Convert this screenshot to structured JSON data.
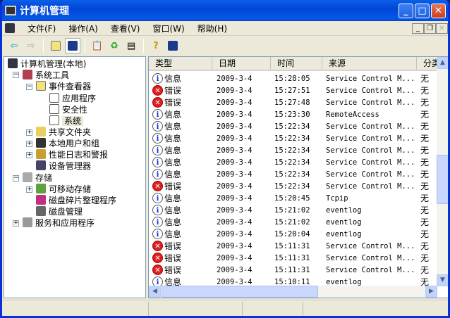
{
  "window": {
    "title": "计算机管理",
    "buttons": {
      "minimize": "_",
      "maximize": "□",
      "close": "✕"
    }
  },
  "menu": [
    "文件(F)",
    "操作(A)",
    "查看(V)",
    "窗口(W)",
    "帮助(H)"
  ],
  "mdi_buttons": {
    "minimize": "_",
    "restore": "❐",
    "close": "✕"
  },
  "toolbar": [
    "back-icon",
    "forward-icon",
    "up-folder-icon",
    "show-hide-tree-icon",
    "properties-icon",
    "refresh-icon",
    "export-list-icon",
    "help-icon",
    "show-action-pane-icon"
  ],
  "tree": {
    "root": "计算机管理(本地)",
    "system_tools": "系统工具",
    "event_viewer": "事件查看器",
    "application": "应用程序",
    "security": "安全性",
    "system": "系统",
    "shared_folders": "共享文件夹",
    "local_users": "本地用户和组",
    "perf_logs": "性能日志和警报",
    "device_manager": "设备管理器",
    "storage": "存储",
    "removable": "可移动存储",
    "defrag": "磁盘碎片整理程序",
    "disk_mgmt": "磁盘管理",
    "services_apps": "服务和应用程序"
  },
  "table": {
    "columns": [
      "类型",
      "日期",
      "时间",
      "来源",
      "分类"
    ],
    "rows": [
      {
        "type": "信息",
        "kind": "info",
        "date": "2009-3-4",
        "time": "15:28:05",
        "source": "Service Control M...",
        "category": "无"
      },
      {
        "type": "错误",
        "kind": "error",
        "date": "2009-3-4",
        "time": "15:27:51",
        "source": "Service Control M...",
        "category": "无"
      },
      {
        "type": "错误",
        "kind": "error",
        "date": "2009-3-4",
        "time": "15:27:48",
        "source": "Service Control M...",
        "category": "无"
      },
      {
        "type": "信息",
        "kind": "info",
        "date": "2009-3-4",
        "time": "15:23:30",
        "source": "RemoteAccess",
        "category": "无"
      },
      {
        "type": "信息",
        "kind": "info",
        "date": "2009-3-4",
        "time": "15:22:34",
        "source": "Service Control M...",
        "category": "无"
      },
      {
        "type": "信息",
        "kind": "info",
        "date": "2009-3-4",
        "time": "15:22:34",
        "source": "Service Control M...",
        "category": "无"
      },
      {
        "type": "信息",
        "kind": "info",
        "date": "2009-3-4",
        "time": "15:22:34",
        "source": "Service Control M...",
        "category": "无"
      },
      {
        "type": "信息",
        "kind": "info",
        "date": "2009-3-4",
        "time": "15:22:34",
        "source": "Service Control M...",
        "category": "无"
      },
      {
        "type": "信息",
        "kind": "info",
        "date": "2009-3-4",
        "time": "15:22:34",
        "source": "Service Control M...",
        "category": "无"
      },
      {
        "type": "错误",
        "kind": "error",
        "date": "2009-3-4",
        "time": "15:22:34",
        "source": "Service Control M...",
        "category": "无"
      },
      {
        "type": "信息",
        "kind": "info",
        "date": "2009-3-4",
        "time": "15:20:45",
        "source": "Tcpip",
        "category": "无"
      },
      {
        "type": "信息",
        "kind": "info",
        "date": "2009-3-4",
        "time": "15:21:02",
        "source": "eventlog",
        "category": "无"
      },
      {
        "type": "信息",
        "kind": "info",
        "date": "2009-3-4",
        "time": "15:21:02",
        "source": "eventlog",
        "category": "无"
      },
      {
        "type": "信息",
        "kind": "info",
        "date": "2009-3-4",
        "time": "15:20:04",
        "source": "eventlog",
        "category": "无"
      },
      {
        "type": "错误",
        "kind": "error",
        "date": "2009-3-4",
        "time": "15:11:31",
        "source": "Service Control M...",
        "category": "无"
      },
      {
        "type": "错误",
        "kind": "error",
        "date": "2009-3-4",
        "time": "15:11:31",
        "source": "Service Control M...",
        "category": "无"
      },
      {
        "type": "错误",
        "kind": "error",
        "date": "2009-3-4",
        "time": "15:11:31",
        "source": "Service Control M...",
        "category": "无"
      },
      {
        "type": "信息",
        "kind": "info",
        "date": "2009-3-4",
        "time": "15:10:11",
        "source": "eventlog",
        "category": "无"
      }
    ]
  },
  "colors": {
    "title_bar": "#0a5fe8",
    "error": "#e02020",
    "info": "#1030d0",
    "selected_tree": "#ece9d8"
  }
}
